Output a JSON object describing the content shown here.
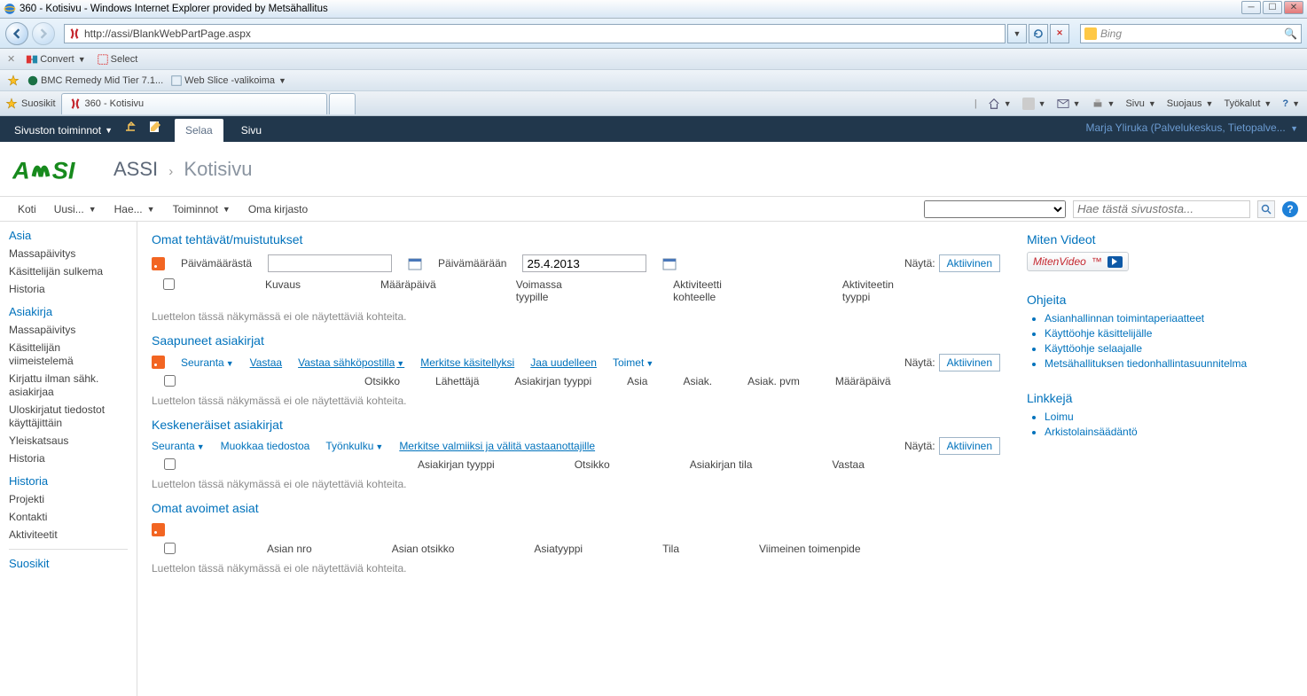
{
  "window": {
    "title": "360 - Kotisivu - Windows Internet Explorer provided by Metsähallitus",
    "url": "http://assi/BlankWebPartPage.aspx",
    "search_provider": "Bing"
  },
  "ie_toolbar": {
    "convert": "Convert",
    "select": "Select"
  },
  "favorites_bar": {
    "item1": "BMC Remedy Mid Tier 7.1...",
    "item2": "Web Slice -valikoima"
  },
  "tab": {
    "favorites": "Suosikit",
    "active_tab": "360 - Kotisivu",
    "right_menu": {
      "sivu": "Sivu",
      "suojaus": "Suojaus",
      "tyokalut": "Työkalut"
    }
  },
  "sp_ribbon": {
    "sitemenu": "Sivuston toiminnot",
    "tab_browse": "Selaa",
    "tab_page": "Sivu",
    "user": "Marja Yliruka (Palvelukeskus, Tietopalve..."
  },
  "breadcrumb": {
    "site": "ASSI",
    "sep": "›",
    "page": "Kotisivu"
  },
  "menubar": {
    "koti": "Koti",
    "uusi": "Uusi...",
    "hae": "Hae...",
    "toiminnot": "Toiminnot",
    "oma": "Oma kirjasto",
    "search_placeholder": "Hae tästä sivustosta..."
  },
  "leftnav": {
    "g1": "Asia",
    "g1_items": [
      "Massapäivitys",
      "Käsittelijän sulkema",
      "Historia"
    ],
    "g2": "Asiakirja",
    "g2_items": [
      "Massapäivitys",
      "Käsittelijän viimeistelemä",
      "Kirjattu ilman sähk. asiakirjaa",
      "Uloskirjatut tiedostot käyttäjittäin",
      "Yleiskatsaus",
      "Historia"
    ],
    "g3": "Historia",
    "g3_items": [
      "Projekti",
      "Kontakti",
      "Aktiviteetit"
    ],
    "g4": "Suosikit"
  },
  "section_omat_teht": {
    "title": "Omat tehtävät/muistutukset",
    "from_lbl": "Päivämäärästä",
    "to_lbl": "Päivämäärään",
    "to_val": "25.4.2013",
    "nayta_lbl": "Näytä:",
    "nayta_val": "Aktiivinen",
    "cols": [
      "Kuvaus",
      "Määräpäivä",
      "Voimassa tyypille",
      "Aktiviteetti kohteelle",
      "Aktiviteetin tyyppi"
    ],
    "empty": "Luettelon tässä näkymässä ei ole näytettäviä kohteita."
  },
  "section_saapuneet": {
    "title": "Saapuneet asiakirjat",
    "toolbar": [
      "Seuranta",
      "Vastaa",
      "Vastaa sähköpostilla",
      "Merkitse käsitellyksi",
      "Jaa uudelleen",
      "Toimet"
    ],
    "nayta_lbl": "Näytä:",
    "nayta_val": "Aktiivinen",
    "cols": [
      "Otsikko",
      "Lähettäjä",
      "Asiakirjan tyyppi",
      "Asia",
      "Asiak.",
      "Asiak. pvm",
      "Määräpäivä"
    ],
    "empty": "Luettelon tässä näkymässä ei ole näytettäviä kohteita."
  },
  "section_kesken": {
    "title": "Keskeneräiset asiakirjat",
    "toolbar": [
      "Seuranta",
      "Muokkaa tiedostoa",
      "Työnkulku",
      "Merkitse valmiiksi ja välitä vastaanottajille"
    ],
    "nayta_lbl": "Näytä:",
    "nayta_val": "Aktiivinen",
    "cols": [
      "Asiakirjan tyyppi",
      "Otsikko",
      "Asiakirjan tila",
      "Vastaa"
    ],
    "empty": "Luettelon tässä näkymässä ei ole näytettäviä kohteita."
  },
  "section_avoimet": {
    "title": "Omat avoimet asiat",
    "cols": [
      "Asian nro",
      "Asian otsikko",
      "Asiatyyppi",
      "Tila",
      "Viimeinen toimenpide"
    ],
    "empty": "Luettelon tässä näkymässä ei ole näytettäviä kohteita."
  },
  "rightcol": {
    "miten_title": "Miten Videot",
    "miten_btn": "MitenVideo",
    "ohjeita_title": "Ohjeita",
    "ohjeita_items": [
      "Asianhallinnan toimintaperiaatteet",
      "Käyttöohje käsittelijälle",
      "Käyttöohje selaajalle",
      "Metsähallituksen tiedonhallintasuunnitelma"
    ],
    "linkkeja_title": "Linkkejä",
    "linkkeja_items": [
      "Loimu",
      "Arkistolainsäädäntö"
    ]
  }
}
